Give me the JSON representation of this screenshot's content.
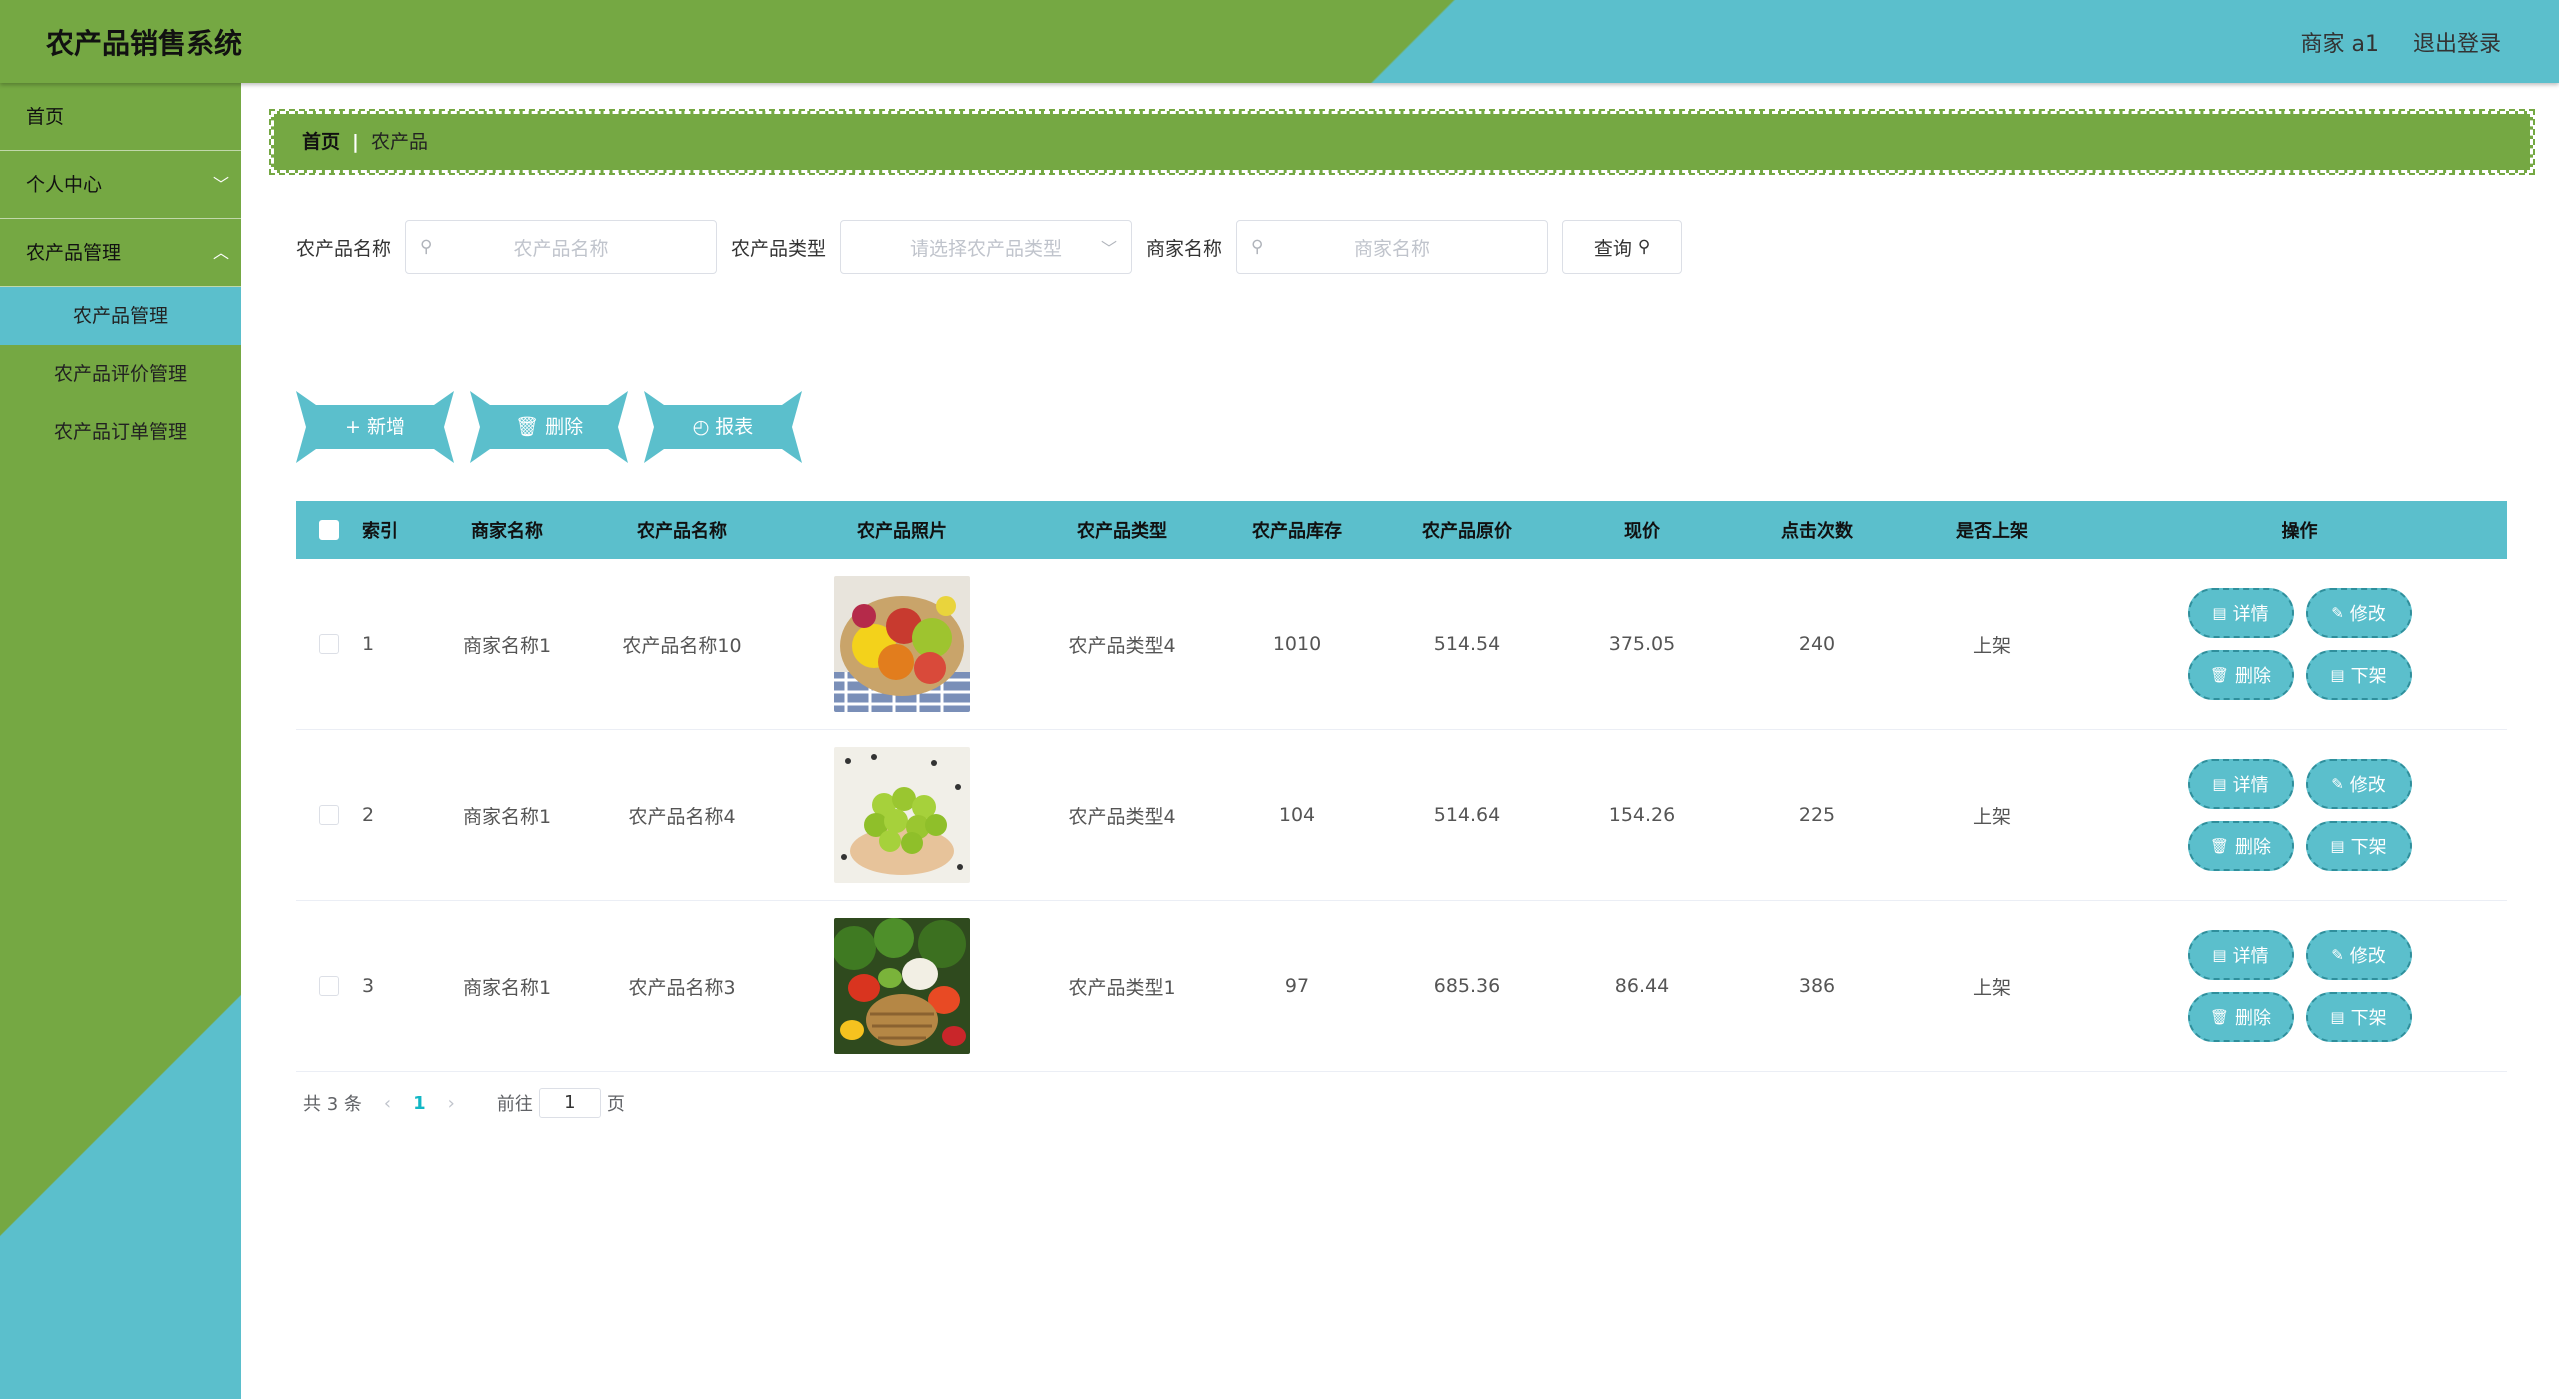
{
  "header": {
    "app_title": "农产品销售系统",
    "user_label": "商家 a1",
    "logout_label": "退出登录"
  },
  "sidebar": {
    "items": [
      {
        "label": "首页"
      },
      {
        "label": "个人中心"
      },
      {
        "label": "农产品管理"
      }
    ],
    "subitems": [
      {
        "label": "农产品管理",
        "active": true
      },
      {
        "label": "农产品评价管理"
      },
      {
        "label": "农产品订单管理"
      }
    ]
  },
  "breadcrumb": {
    "home": "首页",
    "separator": "|",
    "current": "农产品"
  },
  "search": {
    "product_name_label": "农产品名称",
    "product_name_placeholder": "农产品名称",
    "product_type_label": "农产品类型",
    "product_type_placeholder": "请选择农产品类型",
    "merchant_name_label": "商家名称",
    "merchant_name_placeholder": "商家名称",
    "query_label": "查询"
  },
  "actions": {
    "add_label": "新增",
    "delete_label": "删除",
    "report_label": "报表"
  },
  "table": {
    "columns": [
      "索引",
      "商家名称",
      "农产品名称",
      "农产品照片",
      "农产品类型",
      "农产品库存",
      "农产品原价",
      "现价",
      "点击次数",
      "是否上架",
      "操作"
    ],
    "rows": [
      {
        "index": "1",
        "merchant": "商家名称1",
        "name": "农产品名称10",
        "photo": "fruit-bowl",
        "type": "农产品类型4",
        "stock": "1010",
        "orig_price": "514.54",
        "price": "375.05",
        "clicks": "240",
        "on_shelf": "上架"
      },
      {
        "index": "2",
        "merchant": "商家名称1",
        "name": "农产品名称4",
        "photo": "green-grapes",
        "type": "农产品类型4",
        "stock": "104",
        "orig_price": "514.64",
        "price": "154.26",
        "clicks": "225",
        "on_shelf": "上架"
      },
      {
        "index": "3",
        "merchant": "商家名称1",
        "name": "农产品名称3",
        "photo": "vegetable-basket",
        "type": "农产品类型1",
        "stock": "97",
        "orig_price": "685.36",
        "price": "86.44",
        "clicks": "386",
        "on_shelf": "上架"
      }
    ],
    "row_ops": {
      "detail": "详情",
      "edit": "修改",
      "delete": "删除",
      "unshelf": "下架"
    }
  },
  "pager": {
    "total": "共 3 条",
    "current_page": "1",
    "goto_label": "前往",
    "goto_value": "1",
    "page_suffix": "页"
  },
  "colors": {
    "green": "#75a843",
    "teal": "#5bbfcc"
  }
}
